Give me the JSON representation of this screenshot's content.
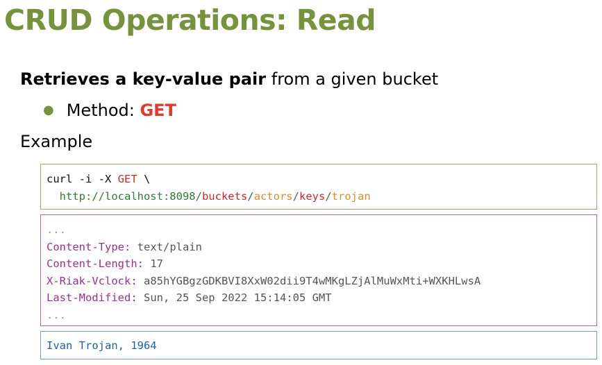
{
  "slide": {
    "title": "CRUD Operations: Read",
    "intro_bold": "Retrieves a key-value pair",
    "intro_rest": " from a given bucket",
    "bullet_label": "Method: ",
    "bullet_value": "GET",
    "example_label": "Example"
  },
  "request": {
    "cmd": "curl -i -X ",
    "method": "GET",
    "cont": " \\",
    "host": "  http://localhost:8098/",
    "seg_buckets": "buckets",
    "slash1": "/",
    "seg_bucket": "actors",
    "slash2": "/",
    "seg_keys": "keys",
    "slash3": "/",
    "seg_key": "trojan"
  },
  "response": {
    "ellipsis_top": "...",
    "headers": [
      {
        "name": "Content-Type:",
        "value": " text/plain"
      },
      {
        "name": "Content-Length:",
        "value": " 17"
      },
      {
        "name": "X-Riak-Vclock:",
        "value": " a85hYGBgzGDKBVI8XxW02dii9T4wMKgLZjAlMuWxMti+WXKHLwsA"
      },
      {
        "name": "Last-Modified:",
        "value": " Sun, 25 Sep 2022 15:14:05 GMT"
      }
    ],
    "ellipsis_bottom": "..."
  },
  "body": {
    "value": "Ivan Trojan, 1964"
  },
  "colors": {
    "title": "#76923c",
    "method": "#e03a2f",
    "request_border": "#8db26a",
    "response_border": "#a868b4",
    "body_border": "#6c9fce"
  }
}
